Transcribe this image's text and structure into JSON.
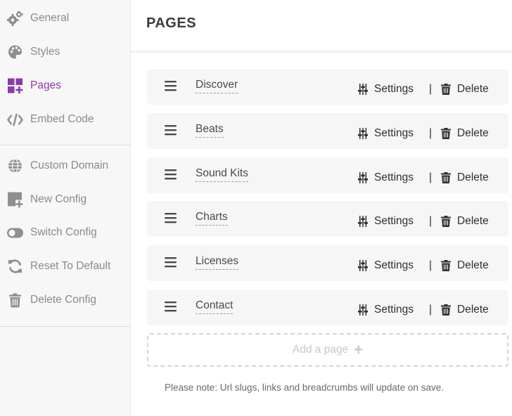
{
  "sidebar": {
    "items": [
      {
        "label": "General",
        "icon": "gears-icon"
      },
      {
        "label": "Styles",
        "icon": "palette-icon"
      },
      {
        "label": "Pages",
        "icon": "pages-grid-icon",
        "active": true
      },
      {
        "label": "Embed Code",
        "icon": "code-icon"
      },
      {
        "label": "Custom Domain",
        "icon": "globe-icon"
      },
      {
        "label": "New Config",
        "icon": "new-config-icon"
      },
      {
        "label": "Switch Config",
        "icon": "toggle-icon"
      },
      {
        "label": "Reset To Default",
        "icon": "sync-icon"
      },
      {
        "label": "Delete Config",
        "icon": "trash-icon"
      }
    ]
  },
  "header": {
    "title": "PAGES"
  },
  "pages": [
    {
      "name": "Discover"
    },
    {
      "name": "Beats"
    },
    {
      "name": "Sound Kits"
    },
    {
      "name": "Charts"
    },
    {
      "name": "Licenses"
    },
    {
      "name": "Contact"
    }
  ],
  "actions": {
    "settings_label": "Settings",
    "separator": "|",
    "delete_label": "Delete"
  },
  "add_page": {
    "label": "Add a page",
    "icon": "plus-icon"
  },
  "note": "Please note: Url slugs, links and breadcrumbs will update on save.",
  "colors": {
    "accent": "#8e3aa8",
    "icon_gray": "#8f8f8f",
    "row_bg": "#f6f6f6"
  }
}
